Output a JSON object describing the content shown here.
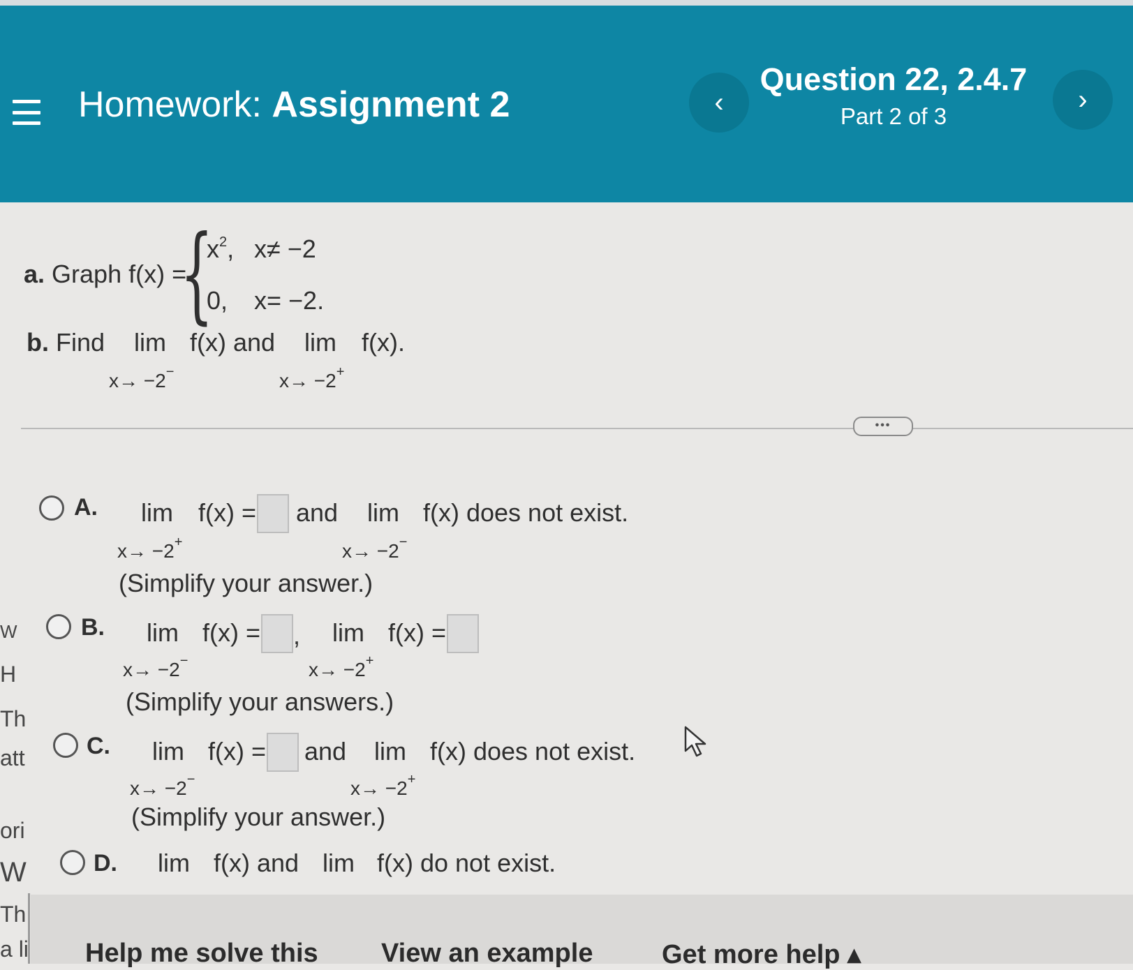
{
  "header": {
    "menu_icon": "hamburger-menu-icon",
    "hw_prefix": "Homework:",
    "hw_name": "Assignment 2",
    "prev_label": "‹",
    "next_label": "›",
    "question_title": "Question 22, 2.4.7",
    "question_part": "Part 2 of 3",
    "accent_color": "#0e86a4"
  },
  "problem": {
    "a_label": "a.",
    "a_text": "Graph f(x) =",
    "case1_expr": "x",
    "case1_exp": "2",
    "case1_comma": ",",
    "case1_cond": "x≠ −2",
    "case2_expr": "0,",
    "case2_cond": "x= −2.",
    "b_label": "b.",
    "b_find": "Find",
    "lim": "lim",
    "b_fx_and": "f(x) and",
    "b_fx_end": "f(x).",
    "b_sub1": "x→ −2",
    "b_sub1_sup": "−",
    "b_sub2": "x→ −2",
    "b_sub2_sup": "+"
  },
  "more_button": "•••",
  "options": {
    "A": {
      "letter": "A.",
      "lim": "lim",
      "fx_eq": "f(x) =",
      "and": "and",
      "lim2": "lim",
      "tail": "f(x) does not exist.",
      "sub1": "x→ −2",
      "sub1_sup": "+",
      "sub2": "x→ −2",
      "sub2_sup": "−",
      "note": "(Simplify your answer.)"
    },
    "B": {
      "letter": "B.",
      "lim": "lim",
      "fx_eq": "f(x) =",
      "comma": ",",
      "lim2": "lim",
      "fx_eq2": "f(x) =",
      "sub1": "x→ −2",
      "sub1_sup": "−",
      "sub2": "x→ −2",
      "sub2_sup": "+",
      "note": "(Simplify your answers.)"
    },
    "C": {
      "letter": "C.",
      "lim": "lim",
      "fx_eq": "f(x) =",
      "and": "and",
      "lim2": "lim",
      "tail": "f(x) does not exist.",
      "sub1": "x→ −2",
      "sub1_sup": "−",
      "sub2": "x→ −2",
      "sub2_sup": "+",
      "note": "(Simplify your answer.)"
    },
    "D": {
      "letter": "D.",
      "lim": "lim",
      "fx_and": "f(x) and",
      "lim2": "lim",
      "tail": "f(x) do not exist."
    }
  },
  "left_fragments": [
    "W",
    "H",
    "Th",
    "att",
    "ori",
    "W",
    "Th",
    "a li"
  ],
  "footer": {
    "help": "Help me solve this",
    "example": "View an example",
    "more": "Get more help ▴"
  }
}
